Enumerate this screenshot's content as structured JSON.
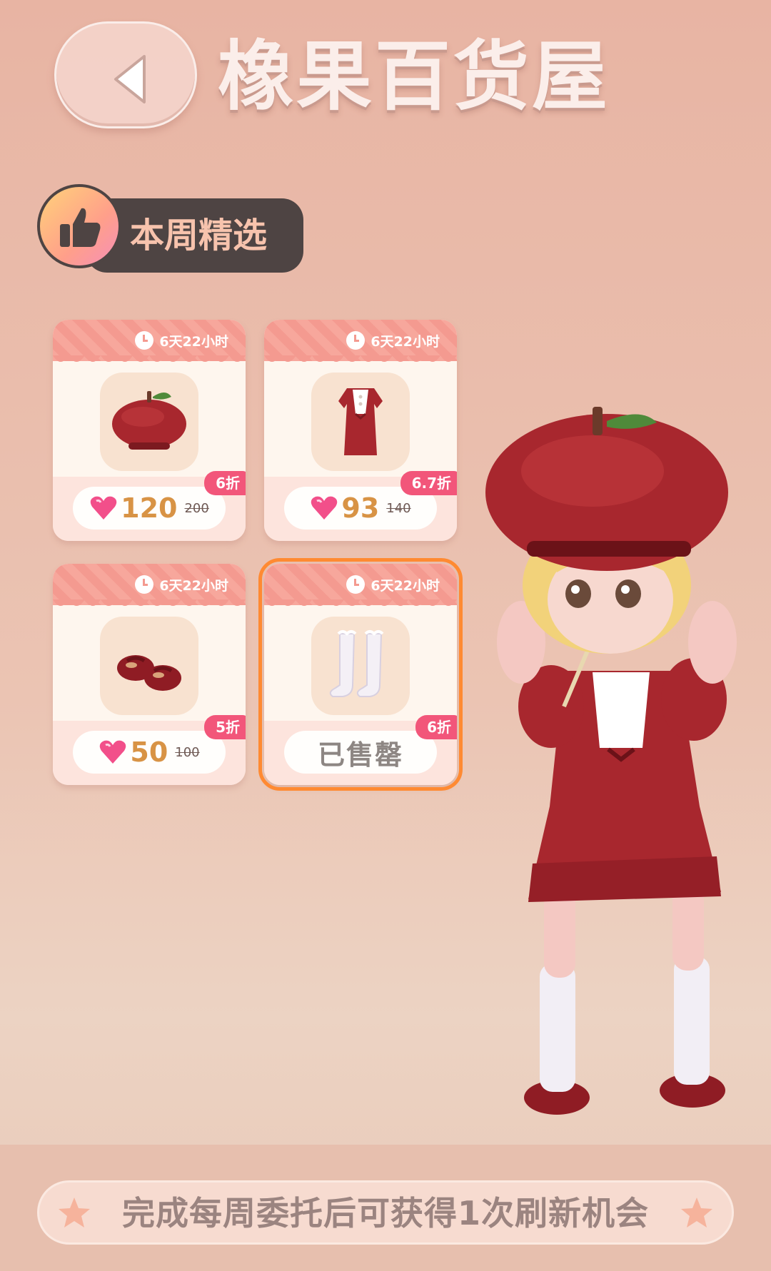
{
  "header": {
    "title": "橡果百货屋",
    "back_icon": "chevron-left-icon"
  },
  "section": {
    "label": "本周精选",
    "icon": "thumbs-up-icon"
  },
  "items": [
    {
      "name": "apple-beret",
      "timer": "6天22小时",
      "price": "120",
      "original_price": "200",
      "discount": "6折",
      "sold_out": false
    },
    {
      "name": "red-dress",
      "timer": "6天22小时",
      "price": "93",
      "original_price": "140",
      "discount": "6.7折",
      "sold_out": false
    },
    {
      "name": "red-shoes",
      "timer": "6天22小时",
      "price": "50",
      "original_price": "100",
      "discount": "5折",
      "sold_out": false
    },
    {
      "name": "white-socks",
      "timer": "6天22小时",
      "sold_label": "已售罄",
      "discount": "6折",
      "sold_out": true
    }
  ],
  "footer": {
    "text": "完成每周委托后可获得1次刷新机会"
  },
  "colors": {
    "accent_pink": "#f2567a",
    "price_orange": "#d89345",
    "selected_outline": "#ff8a32"
  }
}
